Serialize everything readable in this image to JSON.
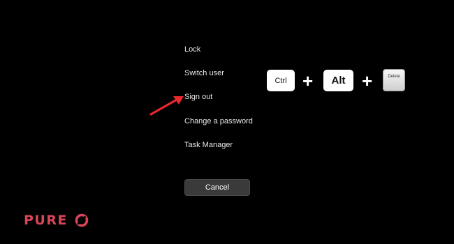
{
  "menu": {
    "items": [
      {
        "label": "Lock"
      },
      {
        "label": "Switch user"
      },
      {
        "label": "Sign out"
      },
      {
        "label": "Change a password"
      },
      {
        "label": "Task Manager"
      }
    ],
    "cancel_label": "Cancel"
  },
  "annotation": {
    "icon": "arrow-icon",
    "target": "Sign out",
    "color": "#e8282d"
  },
  "shortcut": {
    "keys": [
      "Ctrl",
      "Alt",
      "Delete"
    ],
    "separator": "+"
  },
  "brand": {
    "text": "PURE",
    "color": "#d8455a",
    "logo_icon": "ring-logo-icon"
  },
  "colors": {
    "background": "#000000",
    "text": "#e8e8e8",
    "button": "#3a3a3a"
  }
}
